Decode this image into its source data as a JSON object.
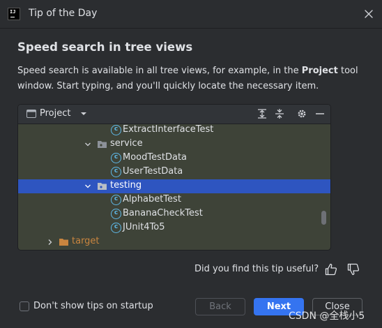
{
  "window": {
    "title": "Tip of the Day"
  },
  "tip": {
    "heading": "Speed search in tree views",
    "text_before": "Speed search is available in all tree views, for example, in the ",
    "text_bold": "Project",
    "text_after": " tool window. Start typing, and you'll quickly locate the necessary item."
  },
  "project_panel": {
    "title": "Project",
    "rows": [
      {
        "label": "ExtractInterfaceTest",
        "type": "class",
        "selected": false
      },
      {
        "label": "service",
        "type": "folder",
        "expanded": true,
        "selected": false
      },
      {
        "label": "MoodTestData",
        "type": "class",
        "selected": false
      },
      {
        "label": "UserTestData",
        "type": "class",
        "selected": false
      },
      {
        "label": "testing",
        "type": "folder",
        "expanded": true,
        "selected": true
      },
      {
        "label": "AlphabetTest",
        "type": "class",
        "selected": false
      },
      {
        "label": "BananaCheckTest",
        "type": "class",
        "selected": false
      },
      {
        "label": "JUnit4To5",
        "type": "class",
        "selected": false
      },
      {
        "label": "target",
        "type": "excluded-folder",
        "expanded": false,
        "selected": false
      }
    ]
  },
  "feedback": {
    "question": "Did you find this tip useful?"
  },
  "footer": {
    "checkbox_label": "Don't show tips on startup",
    "checkbox_checked": false,
    "back_label": "Back",
    "next_label": "Next",
    "close_label": "Close"
  },
  "watermark": "CSDN @全栈小5",
  "colors": {
    "background": "#2b2d30",
    "tree_background": "#3e4338",
    "selection": "#2e55c0",
    "primary_button": "#3574f0",
    "class_icon": "#5fb9e8",
    "excluded_folder": "#c9853f"
  }
}
